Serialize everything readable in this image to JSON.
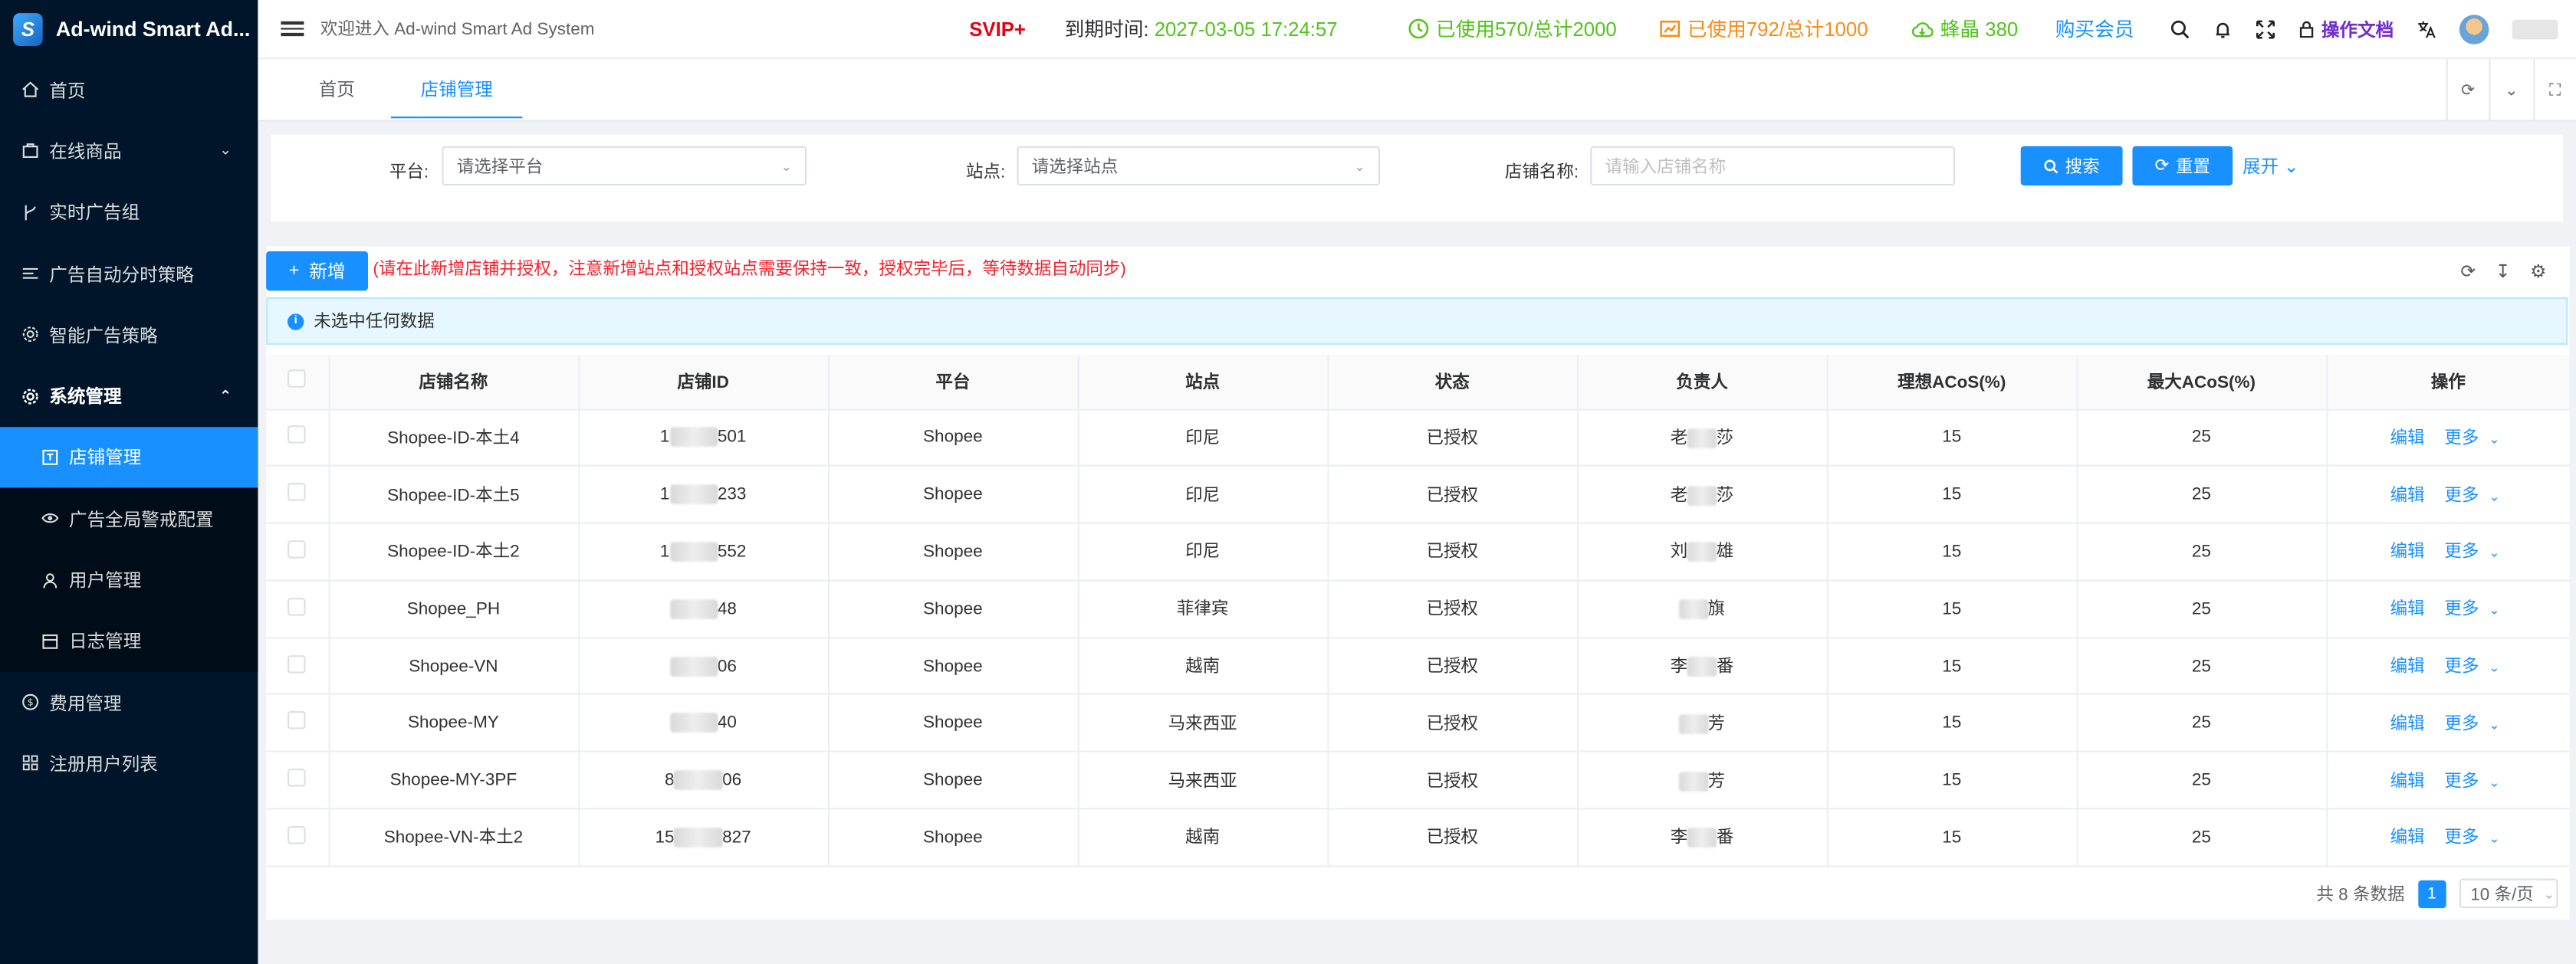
{
  "app": {
    "title": "Ad-wind Smart Ad...",
    "logo_letter": "S"
  },
  "sidebar": {
    "items": [
      {
        "label": "首页",
        "icon": "home-icon"
      },
      {
        "label": "在线商品",
        "icon": "bag-icon"
      },
      {
        "label": "实时广告组",
        "icon": "branch-icon"
      },
      {
        "label": "广告自动分时策略",
        "icon": "list-icon"
      },
      {
        "label": "智能广告策略",
        "icon": "gear-icon"
      },
      {
        "label": "系统管理",
        "icon": "settings-icon"
      },
      {
        "label": "店铺管理",
        "icon": "shop-icon"
      },
      {
        "label": "广告全局警戒配置",
        "icon": "eye-icon"
      },
      {
        "label": "用户管理",
        "icon": "user-icon"
      },
      {
        "label": "日志管理",
        "icon": "calendar-icon"
      },
      {
        "label": "费用管理",
        "icon": "dollar-icon"
      },
      {
        "label": "注册用户列表",
        "icon": "grid-icon"
      }
    ]
  },
  "header": {
    "welcome": "欢迎进入 Ad-wind Smart Ad System",
    "svip": "SVIP+",
    "expire_label": "到期时间:",
    "expire_value": "2027-03-05 17:24:57",
    "used_1": "已使用570/总计2000",
    "used_2": "已使用792/总计1000",
    "crystal": "蜂晶 380",
    "buy": "购买会员",
    "docs": "操作文档"
  },
  "tabs": [
    {
      "label": "首页"
    },
    {
      "label": "店铺管理"
    }
  ],
  "search": {
    "platform_label": "平台:",
    "platform_placeholder": "请选择平台",
    "site_label": "站点:",
    "site_placeholder": "请选择站点",
    "shop_label": "店铺名称:",
    "shop_placeholder": "请输入店铺名称",
    "search_btn": "搜索",
    "reset_btn": "重置",
    "expand": "展开"
  },
  "toolbar": {
    "add_btn": "新增",
    "tip": "(请在此新增店铺并授权，注意新增站点和授权站点需要保持一致，授权完毕后，等待数据自动同步)",
    "selection_info": "未选中任何数据"
  },
  "table": {
    "headers": [
      "店铺名称",
      "店铺ID",
      "平台",
      "站点",
      "状态",
      "负责人",
      "理想ACoS(%)",
      "最大ACoS(%)",
      "操作"
    ],
    "rows": [
      {
        "name": "Shopee-ID-本土4",
        "id_pre": "1",
        "id_post": "501",
        "platform": "Shopee",
        "site": "印尼",
        "status": "已授权",
        "owner_pre": "老",
        "owner_post": "莎",
        "ideal": "15",
        "max": "25"
      },
      {
        "name": "Shopee-ID-本土5",
        "id_pre": "1",
        "id_post": "233",
        "platform": "Shopee",
        "site": "印尼",
        "status": "已授权",
        "owner_pre": "老",
        "owner_post": "莎",
        "ideal": "15",
        "max": "25"
      },
      {
        "name": "Shopee-ID-本土2",
        "id_pre": "1",
        "id_post": "552",
        "platform": "Shopee",
        "site": "印尼",
        "status": "已授权",
        "owner_pre": "刘",
        "owner_post": "雄",
        "ideal": "15",
        "max": "25"
      },
      {
        "name": "Shopee_PH",
        "id_pre": "",
        "id_post": "48",
        "platform": "Shopee",
        "site": "菲律宾",
        "status": "已授权",
        "owner_pre": "",
        "owner_post": "旗",
        "ideal": "15",
        "max": "25"
      },
      {
        "name": "Shopee-VN",
        "id_pre": "",
        "id_post": "06",
        "platform": "Shopee",
        "site": "越南",
        "status": "已授权",
        "owner_pre": "李",
        "owner_post": "番",
        "ideal": "15",
        "max": "25"
      },
      {
        "name": "Shopee-MY",
        "id_pre": "",
        "id_post": "40",
        "platform": "Shopee",
        "site": "马来西亚",
        "status": "已授权",
        "owner_pre": "",
        "owner_post": "芳",
        "ideal": "15",
        "max": "25"
      },
      {
        "name": "Shopee-MY-3PF",
        "id_pre": "8",
        "id_post": "06",
        "platform": "Shopee",
        "site": "马来西亚",
        "status": "已授权",
        "owner_pre": "",
        "owner_post": "芳",
        "ideal": "15",
        "max": "25"
      },
      {
        "name": "Shopee-VN-本土2",
        "id_pre": "15",
        "id_post": "827",
        "platform": "Shopee",
        "site": "越南",
        "status": "已授权",
        "owner_pre": "李",
        "owner_post": "番",
        "ideal": "15",
        "max": "25"
      }
    ],
    "edit": "编辑",
    "more": "更多"
  },
  "pagination": {
    "total": "共 8 条数据",
    "page": "1",
    "size": "10 条/页"
  }
}
